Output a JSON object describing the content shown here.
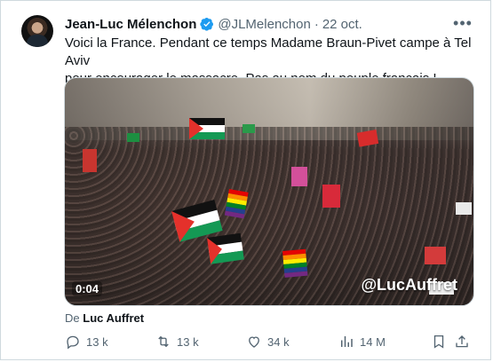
{
  "tweet": {
    "author_name": "Jean-Luc Mélenchon",
    "author_handle": "@JLMelenchon",
    "separator": "·",
    "date": "22 oct.",
    "text_line1": "Voici la France. Pendant ce temps Madame Braun-Pivet campe à Tel Aviv",
    "text_line2": "pour encourager le massacre. Pas au nom du peuple français !",
    "video_time": "0:04",
    "video_watermark": "@LucAuffret",
    "source_prefix": "De",
    "source_name": "Luc Auffret"
  },
  "actions": {
    "replies": "13 k",
    "reposts": "13 k",
    "likes": "34 k",
    "views": "14 M"
  },
  "colors": {
    "text": "#0f1419",
    "secondary": "#536471",
    "verified": "#1d9bf0",
    "border": "#cfd9de"
  },
  "icons": {
    "verified": "verified-badge-icon",
    "more": "more-dots-icon",
    "reply": "reply-icon",
    "repost": "repost-icon",
    "like": "heart-icon",
    "views": "views-bar-chart-icon",
    "bookmark": "bookmark-icon",
    "share": "share-icon"
  }
}
